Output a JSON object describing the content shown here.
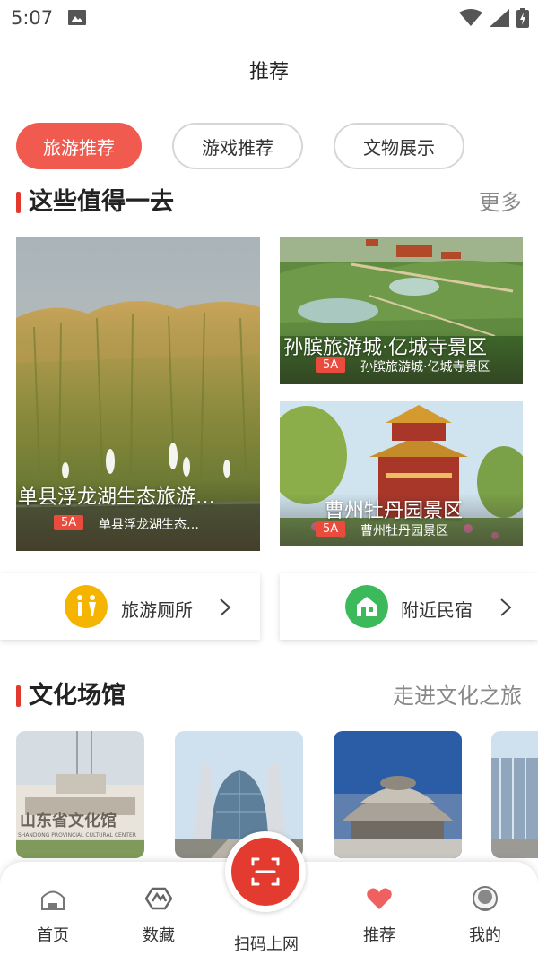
{
  "status": {
    "time": "5:07"
  },
  "page": {
    "title": "推荐"
  },
  "tabs": [
    {
      "label": "旅游推荐",
      "active": true
    },
    {
      "label": "游戏推荐",
      "active": false
    },
    {
      "label": "文物展示",
      "active": false
    }
  ],
  "section_worth": {
    "title": "这些值得一去",
    "more": "更多"
  },
  "attractions": [
    {
      "title": "单县浮龙湖生态旅游…",
      "badge": "5A",
      "subtitle": "单县浮龙湖生态…"
    },
    {
      "title": "孙膑旅游城·亿城寺景区",
      "badge": "5A",
      "subtitle": "孙膑旅游城·亿城寺景区"
    },
    {
      "title": "曹州牡丹园景区",
      "badge": "5A",
      "subtitle": "曹州牡丹园景区"
    }
  ],
  "quick_links": [
    {
      "label": "旅游厕所",
      "icon": "toilet-icon",
      "color": "#f5b400"
    },
    {
      "label": "附近民宿",
      "icon": "homestay-icon",
      "color": "#3cb95a"
    }
  ],
  "section_culture": {
    "title": "文化场馆",
    "more": "走进文化之旅"
  },
  "venue_photo": {
    "sign": "山东省文化馆",
    "sign_en": "SHANDONG PROVINCIAL CULTURAL CENTER"
  },
  "nav": [
    {
      "label": "首页",
      "icon": "home-icon"
    },
    {
      "label": "数藏",
      "icon": "collection-icon"
    },
    {
      "label": "扫码上网",
      "icon": "scan-icon"
    },
    {
      "label": "推荐",
      "icon": "heart-icon",
      "active": true
    },
    {
      "label": "我的",
      "icon": "profile-icon"
    }
  ],
  "colors": {
    "accent": "#f05a4f",
    "nav_active": "#f06060",
    "badge": "#e94b3c"
  }
}
